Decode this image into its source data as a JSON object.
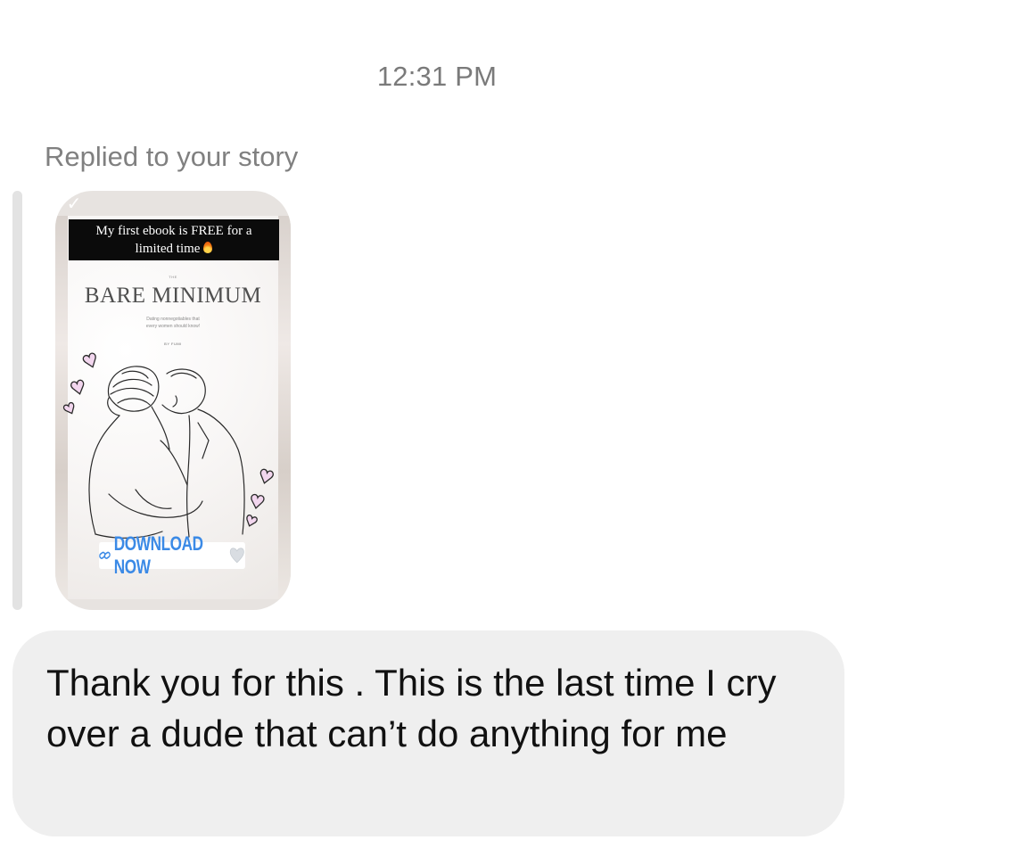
{
  "thread": {
    "timestamp": "12:31 PM",
    "reply_caption": "Replied to your story",
    "story": {
      "banner_line1": "My first ebook is FREE for a",
      "banner_line2": "limited time",
      "banner_icon": "fire-icon",
      "book_the": "THE",
      "book_title": "BARE MINIMUM",
      "book_subtitle_line1": "Dating nonnegotiables that",
      "book_subtitle_line2": "every women should know!",
      "book_author": "BY FUMI",
      "download_label": "DOWNLOAD NOW",
      "link_icon": "link-icon",
      "heart_icon": "heart-icon",
      "accent_color": "#3b8ae6"
    },
    "message": {
      "text": "Thank you for this . This is the last time I cry over a dude that can’t do anything for me",
      "bubble_color": "#efefef"
    }
  }
}
